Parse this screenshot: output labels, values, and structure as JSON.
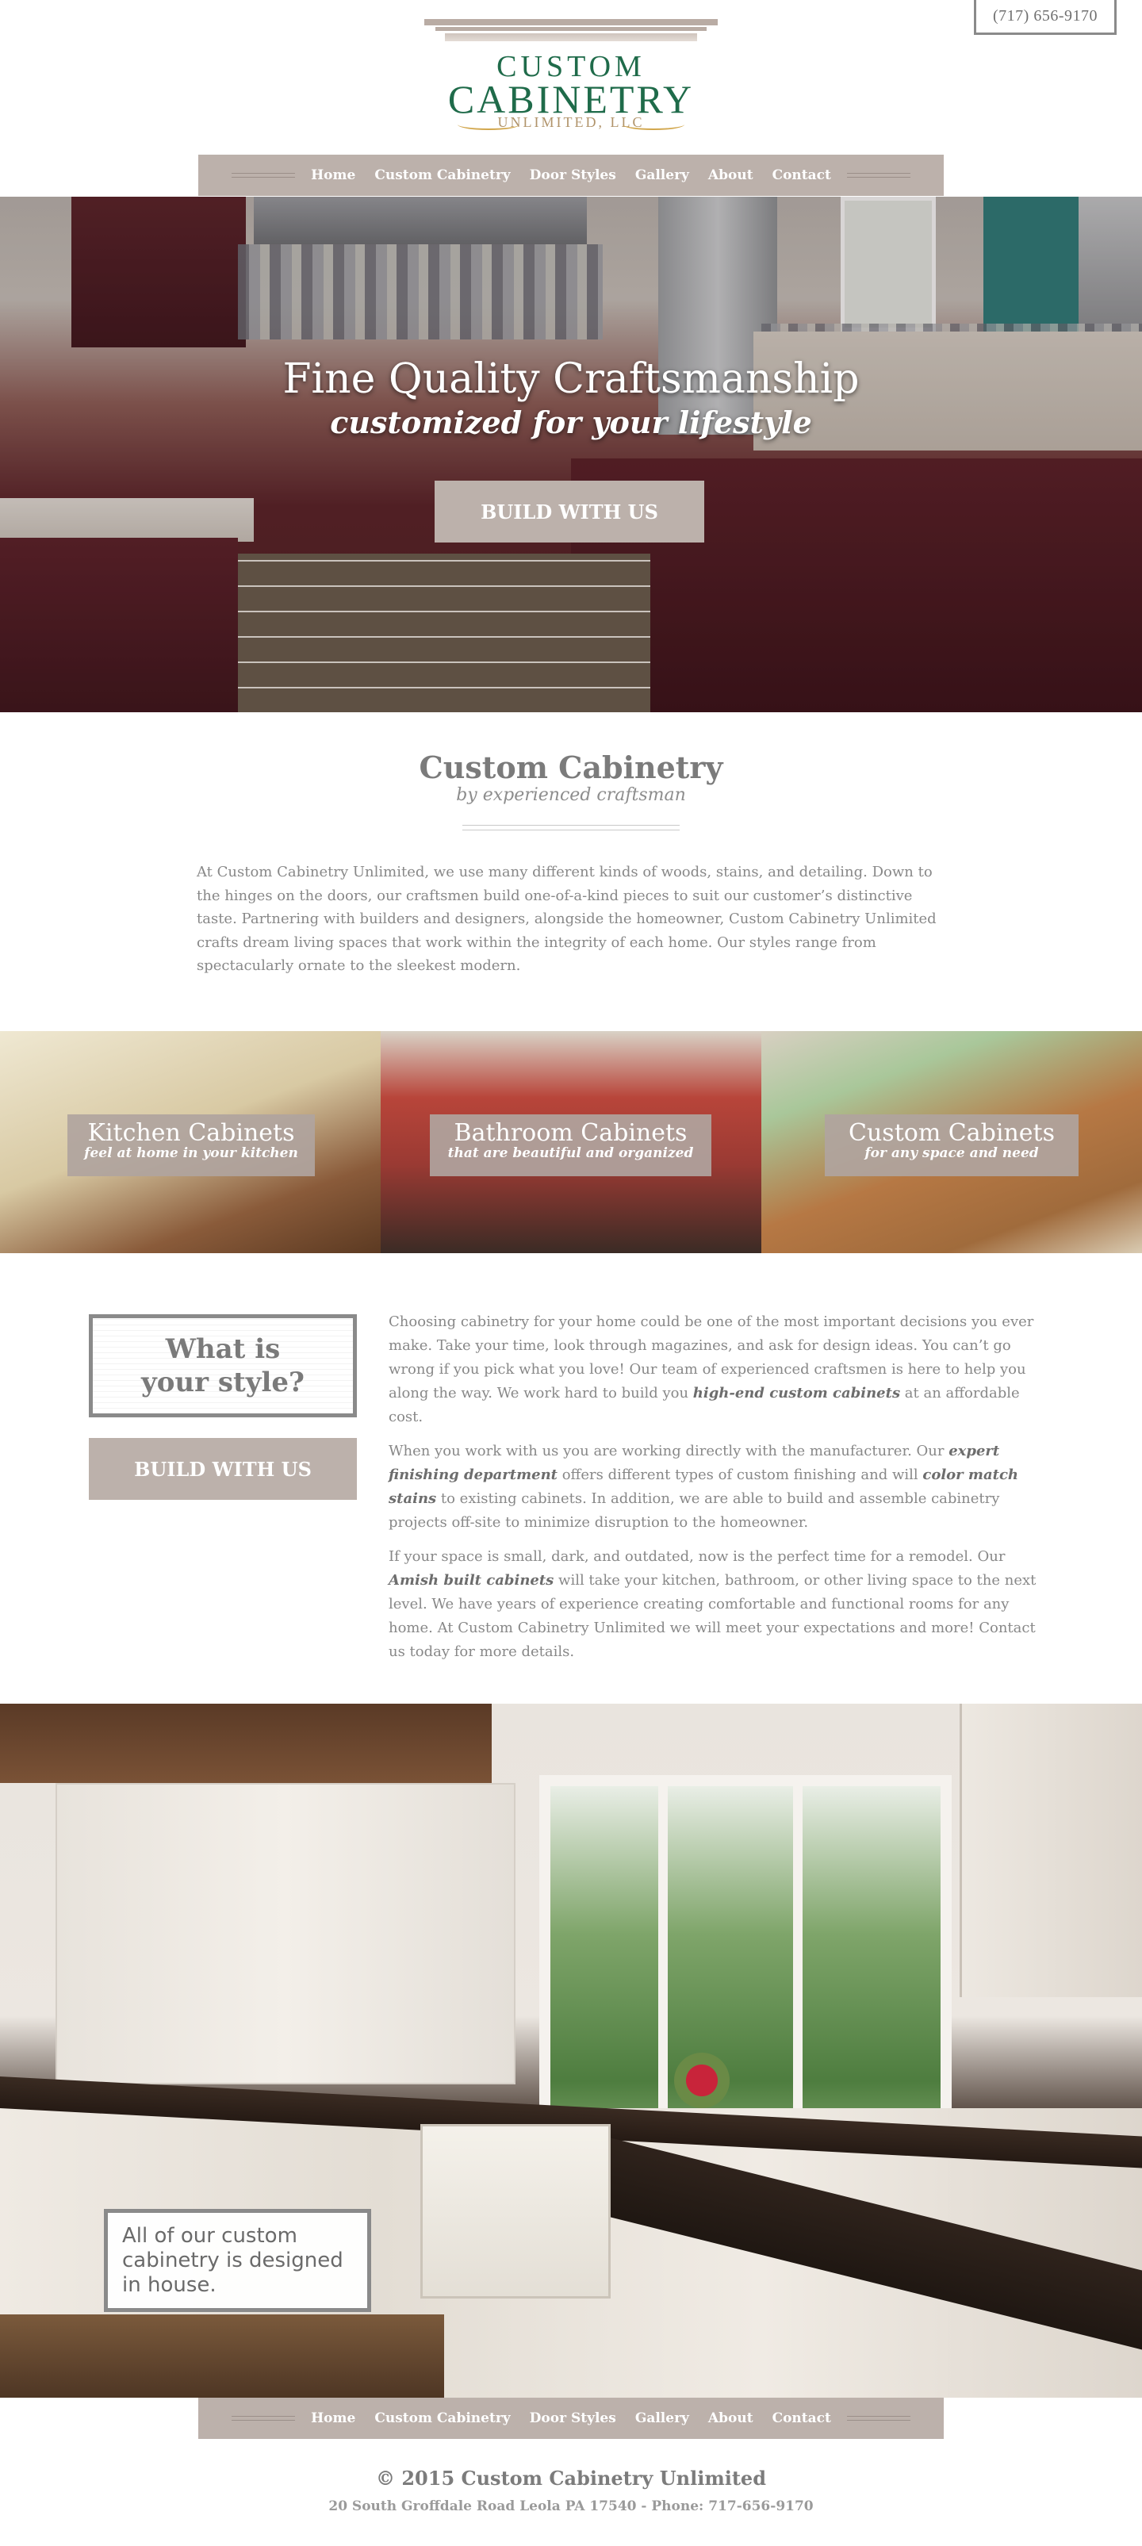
{
  "header": {
    "phone": "(717) 656-9170",
    "logo_line1": "CUSTOM",
    "logo_line2": "CABINETRY",
    "logo_line3": "UNLIMITED, LLC"
  },
  "nav": {
    "items": [
      "Home",
      "Custom Cabinetry",
      "Door Styles",
      "Gallery",
      "About",
      "Contact"
    ]
  },
  "hero": {
    "title": "Fine Quality Craftsmanship",
    "subtitle": "customized for your lifestyle",
    "button": "BUILD WITH US"
  },
  "intro": {
    "title": "Custom Cabinetry",
    "subtitle": "by experienced craftsman",
    "body": "At Custom Cabinetry Unlimited, we use many different kinds of woods, stains, and detailing. Down to the hinges on the doors, our craftsmen build one-of-a-kind pieces to suit our customer’s distinctive taste. Partnering with builders and designers, alongside the homeowner, Custom Cabinetry Unlimited crafts dream living spaces that work within the integrity of each home. Our styles range from spectacularly ornate to the sleekest modern."
  },
  "categories": [
    {
      "title": "Kitchen Cabinets",
      "subtitle": "feel at home in your kitchen"
    },
    {
      "title": "Bathroom Cabinets",
      "subtitle": "that are beautiful and organized"
    },
    {
      "title": "Custom Cabinets",
      "subtitle": "for any space and need"
    }
  ],
  "style_section": {
    "box_line1": "What is",
    "box_line2": "your style?",
    "button": "BUILD WITH US",
    "p1_a": "Choosing cabinetry for your home could be one of the most important decisions you ever make. Take your time, look through magazines, and ask for design ideas. You can’t go wrong if you pick what you love! Our team of experienced craftsmen is here to help you along the way. We work hard to build you ",
    "p1_b": "high-end custom cabinets",
    "p1_c": " at an affordable cost.",
    "p2_a": "When you work with us you are working directly with the manufacturer. Our ",
    "p2_b": "expert finishing department",
    "p2_c": " offers different types of custom finishing and will ",
    "p2_d": "color match stains",
    "p2_e": " to existing cabinets. In addition, we are able to build and assemble cabinetry projects off-site to minimize disruption to the homeowner.",
    "p3_a": "If your space is small, dark, and outdated, now is the perfect time for a remodel. Our ",
    "p3_b": "Amish built cabinets",
    "p3_c": " will take your kitchen, bathroom, or other living space to the next level. We have years of experience creating comfortable and functional rooms for any home. At Custom Cabinetry Unlimited we will meet your expectations and more! Contact us today for more details."
  },
  "kitchen_note": "All of our custom cabinetry is designed in house.",
  "footer": {
    "copyright": "© 2015 Custom Cabinetry Unlimited",
    "address": "20 South Groffdale Road Leola PA 17540 - Phone: 717-656-9170"
  },
  "colors": {
    "brand_green": "#1f6b4a",
    "accent_taupe": "#bcb1ab",
    "text_gray": "#888888"
  }
}
